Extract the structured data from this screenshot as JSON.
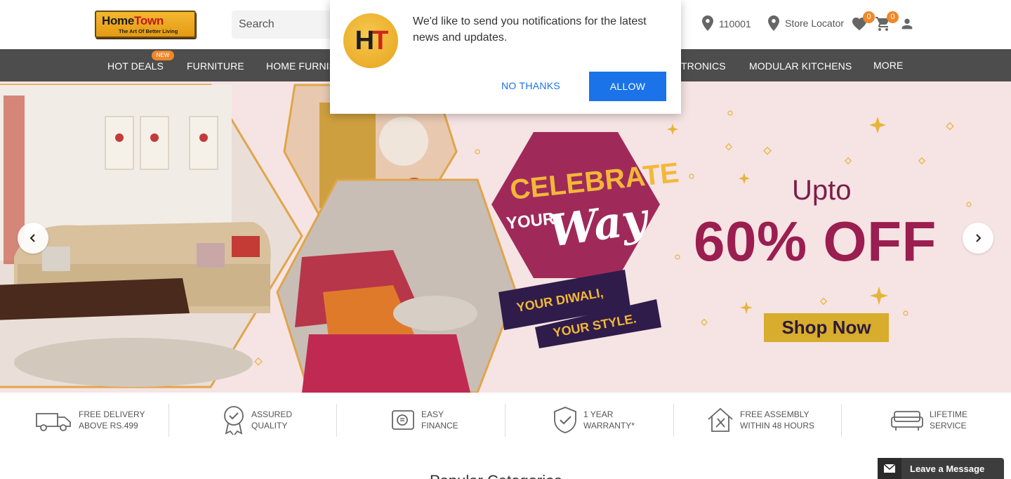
{
  "header": {
    "logo": {
      "brand_a": "Home",
      "brand_b": "Town",
      "tagline": "The Art Of Better Living"
    },
    "search": {
      "placeholder": "Search"
    },
    "pincode": "110001",
    "store_locator": "Store Locator",
    "wishlist_count": "0",
    "cart_count": "0"
  },
  "nav": {
    "new_badge": "NEW",
    "items": [
      "HOT DEALS",
      "FURNITURE",
      "HOME FURNIS",
      "TRONICS",
      "MODULAR KITCHENS",
      "MORE"
    ]
  },
  "banner": {
    "headline_1": "CELEBRATE",
    "headline_2": "YOUR",
    "headline_3": "Way",
    "tag_1": "YOUR DIWALI,",
    "tag_2": "YOUR STYLE.",
    "upto": "Upto",
    "discount": "60% OFF",
    "cta": "Shop Now"
  },
  "features": [
    {
      "line1": "FREE DELIVERY",
      "line2": "ABOVE RS.499",
      "icon": "truck-icon"
    },
    {
      "line1": "ASSURED",
      "line2": "QUALITY",
      "icon": "badge-icon"
    },
    {
      "line1": "EASY",
      "line2": "FINANCE",
      "icon": "finance-icon"
    },
    {
      "line1": "1 YEAR",
      "line2": "WARRANTY*",
      "icon": "shield-check-icon"
    },
    {
      "line1": "FREE ASSEMBLY",
      "line2": "WITHIN 48 HOURS",
      "icon": "house-tools-icon"
    },
    {
      "line1": "LIFETIME",
      "line2": "SERVICE",
      "icon": "sofa-icon"
    }
  ],
  "popup": {
    "logo_h": "H",
    "logo_t": "T",
    "message": "We'd like to send you notifications for the latest news and updates.",
    "no_thanks": "NO THANKS",
    "allow": "ALLOW"
  },
  "chat": {
    "label": "Leave a Message"
  },
  "section_peek": "Popular Categories",
  "colors": {
    "nav_bg": "#4d4d4d",
    "accent": "#f0882a",
    "banner_bg": "#f6e3e3",
    "discount": "#9a1e50",
    "allow_button": "#1a73e8"
  }
}
